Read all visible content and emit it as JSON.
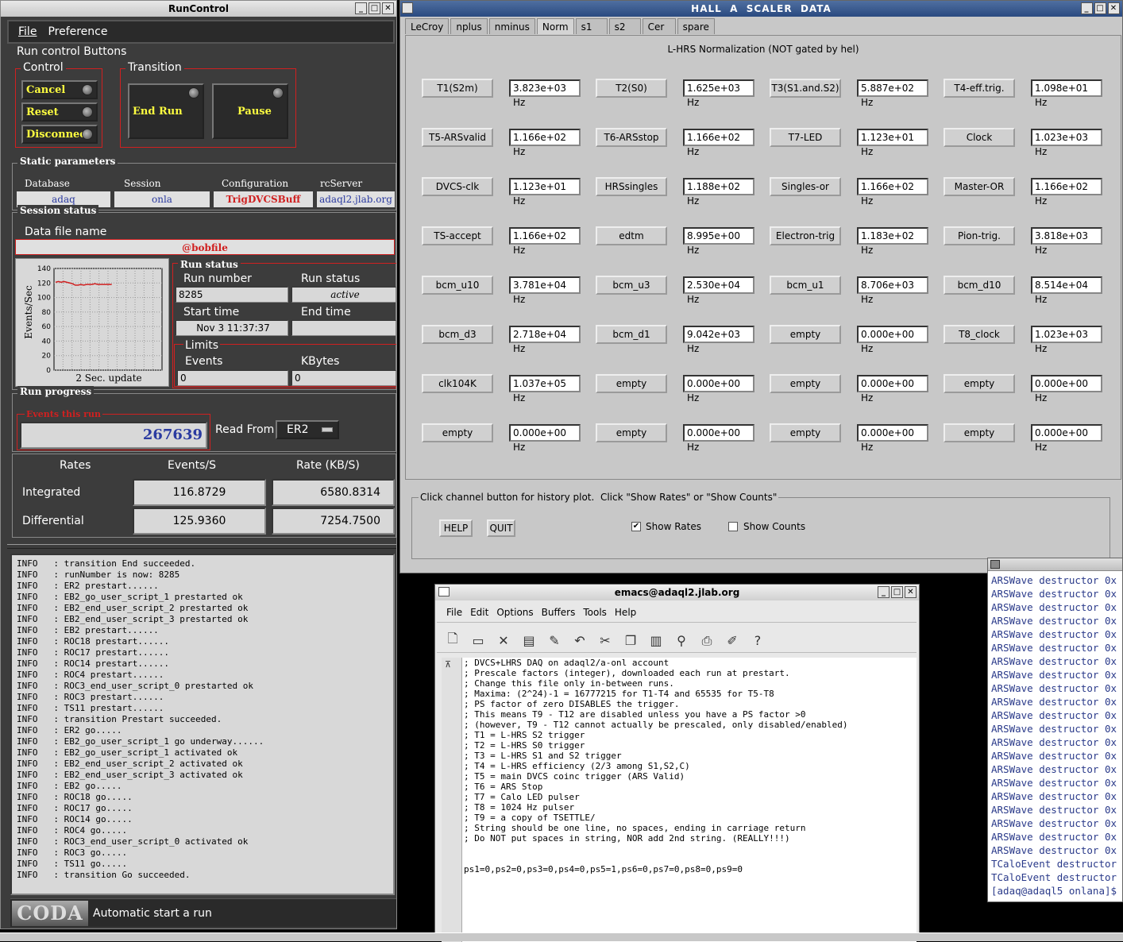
{
  "runcontrol": {
    "title": "RunControl",
    "menu": [
      "File",
      "Preference"
    ],
    "buttons_group": "Run control Buttons",
    "control_label": "Control",
    "transition_label": "Transition",
    "cancel": "Cancel",
    "reset": "Reset",
    "disconnect": "Disconnect",
    "end_run": "End Run",
    "pause": "Pause",
    "static_params": "Static parameters",
    "database_label": "Database",
    "database": "adaq",
    "session_label": "Session",
    "session": "onla",
    "config_label": "Configuration",
    "config": "TrigDVCSBuff",
    "rcserver_label": "rcServer",
    "rcserver": "adaql2.jlab.org",
    "session_status": "Session status",
    "data_file_label": "Data file name",
    "data_file": "@bobfile",
    "plot_ylabel": "Events/Sec",
    "plot_xlabel": "2 Sec. update",
    "run_status_group": "Run status",
    "run_number_label": "Run number",
    "run_number": "8285",
    "run_status_label": "Run status",
    "run_status": "active",
    "start_time_label": "Start time",
    "start_time": "Nov 3 11:37:37",
    "end_time_label": "End time",
    "end_time": "",
    "limits_label": "Limits",
    "events_label": "Events",
    "events_limit": "0",
    "kbytes_label": "KBytes",
    "kbytes_limit": "0",
    "run_progress": "Run progress",
    "events_this_run_label": "Events this run",
    "events_this_run": "267639",
    "read_from_label": "Read From:",
    "read_from": "ER2",
    "rates_header": "Rates",
    "events_s_header": "Events/S",
    "rate_kbs_header": "Rate (KB/S)",
    "integrated_label": "Integrated",
    "integrated_events": "116.8729",
    "integrated_rate": "6580.8314",
    "differential_label": "Differential",
    "differential_events": "125.9360",
    "differential_rate": "7254.7500",
    "coda_logo": "CODA",
    "footer_status": "Automatic start a run",
    "log": [
      "INFO   : transition End succeeded.",
      "INFO   : runNumber is now: 8285",
      "INFO   : ER2 prestart......",
      "INFO   : EB2_go_user_script_1 prestarted ok",
      "INFO   : EB2_end_user_script_2 prestarted ok",
      "INFO   : EB2_end_user_script_3 prestarted ok",
      "INFO   : EB2 prestart......",
      "INFO   : ROC18 prestart......",
      "INFO   : ROC17 prestart......",
      "INFO   : ROC14 prestart......",
      "INFO   : ROC4 prestart......",
      "INFO   : ROC3_end_user_script_0 prestarted ok",
      "INFO   : ROC3 prestart......",
      "INFO   : TS11 prestart......",
      "INFO   : transition Prestart succeeded.",
      "INFO   : ER2 go.....",
      "INFO   : EB2_go_user_script_1 go underway......",
      "INFO   : EB2_go_user_script_1 activated ok",
      "INFO   : EB2_end_user_script_2 activated ok",
      "INFO   : EB2_end_user_script_3 activated ok",
      "INFO   : EB2 go.....",
      "INFO   : ROC18 go.....",
      "INFO   : ROC17 go.....",
      "INFO   : ROC14 go.....",
      "INFO   : ROC4 go.....",
      "INFO   : ROC3_end_user_script_0 activated ok",
      "INFO   : ROC3 go.....",
      "INFO   : TS11 go.....",
      "INFO   : transition Go succeeded."
    ]
  },
  "chart_data": {
    "type": "line",
    "xlabel": "2 Sec. update",
    "ylabel": "Events/Sec",
    "ylim": [
      0,
      140
    ],
    "yticks": [
      0,
      20,
      40,
      60,
      80,
      100,
      120,
      140
    ],
    "grid": true,
    "series": [
      {
        "values": [
          121,
          122,
          121,
          122,
          121,
          120,
          119,
          117,
          117,
          118,
          117,
          118,
          118,
          118,
          119,
          118,
          118,
          118,
          118,
          118,
          118
        ]
      }
    ]
  },
  "scaler": {
    "title": "HALL  A  SCALER  DATA",
    "tabs": [
      "LeCroy",
      "nplus",
      "nminus",
      "Norm",
      "s1",
      "s2",
      "Cer",
      "spare"
    ],
    "active_tab": "Norm",
    "heading": "L-HRS Normalization (NOT gated by hel)",
    "rows": [
      [
        [
          "T1(S2m)",
          "3.823e+03 Hz"
        ],
        [
          "T2(S0)",
          "1.625e+03 Hz"
        ],
        [
          "T3(S1.and.S2)",
          "5.887e+02 Hz"
        ],
        [
          "T4-eff.trig.",
          "1.098e+01 Hz"
        ]
      ],
      [
        [
          "T5-ARSvalid",
          "1.166e+02 Hz"
        ],
        [
          "T6-ARSstop",
          "1.166e+02 Hz"
        ],
        [
          "T7-LED",
          "1.123e+01 Hz"
        ],
        [
          "Clock",
          "1.023e+03 Hz"
        ]
      ],
      [
        [
          "DVCS-clk",
          "1.123e+01 Hz"
        ],
        [
          "HRSsingles",
          "1.188e+02 Hz"
        ],
        [
          "Singles-or",
          "1.166e+02 Hz"
        ],
        [
          "Master-OR",
          "1.166e+02 Hz"
        ]
      ],
      [
        [
          "TS-accept",
          "1.166e+02 Hz"
        ],
        [
          "edtm",
          "8.995e+00 Hz"
        ],
        [
          "Electron-trig",
          "1.183e+02 Hz"
        ],
        [
          "Pion-trig.",
          "3.818e+03 Hz"
        ]
      ],
      [
        [
          "bcm_u10",
          "3.781e+04 Hz"
        ],
        [
          "bcm_u3",
          "2.530e+04 Hz"
        ],
        [
          "bcm_u1",
          "8.706e+03 Hz"
        ],
        [
          "bcm_d10",
          "8.514e+04 Hz"
        ]
      ],
      [
        [
          "bcm_d3",
          "2.718e+04 Hz"
        ],
        [
          "bcm_d1",
          "9.042e+03 Hz"
        ],
        [
          "empty",
          "0.000e+00 Hz"
        ],
        [
          "T8_clock",
          "1.023e+03 Hz"
        ]
      ],
      [
        [
          "clk104K",
          "1.037e+05 Hz"
        ],
        [
          "empty",
          "0.000e+00 Hz"
        ],
        [
          "empty",
          "0.000e+00 Hz"
        ],
        [
          "empty",
          "0.000e+00 Hz"
        ]
      ],
      [
        [
          "empty",
          "0.000e+00 Hz"
        ],
        [
          "empty",
          "0.000e+00 Hz"
        ],
        [
          "empty",
          "0.000e+00 Hz"
        ],
        [
          "empty",
          "0.000e+00 Hz"
        ]
      ]
    ],
    "instructions": "Click channel button for history plot.  Click \"Show Rates\" or \"Show Counts\"",
    "help": "HELP",
    "quit": "QUIT",
    "show_rates": "Show Rates",
    "show_counts": "Show Counts"
  },
  "emacs": {
    "title": "emacs@adaql2.jlab.org",
    "menu": [
      "File",
      "Edit",
      "Options",
      "Buffers",
      "Tools",
      "Help"
    ],
    "text": [
      "; DVCS+LHRS DAQ on adaql2/a-onl account",
      "; Prescale factors (integer), downloaded each run at prestart.",
      "; Change this file only in-between runs.",
      "; Maxima: (2^24)-1 = 16777215 for T1-T4 and 65535 for T5-T8",
      "; PS factor of zero DISABLES the trigger.",
      "; This means T9 - T12 are disabled unless you have a PS factor >0",
      "; (however, T9 - T12 cannot actually be prescaled, only disabled/enabled)",
      "; T1 = L-HRS S2 trigger",
      "; T2 = L-HRS S0 trigger",
      "; T3 = L-HRS S1 and S2 trigger",
      "; T4 = L-HRS efficiency (2/3 among S1,S2,C)",
      "; T5 = main DVCS coinc trigger (ARS Valid)",
      "; T6 = ARS Stop",
      "; T7 = Calo LED pulser",
      "; T8 = 1024 Hz pulser",
      "; T9 = a copy of TSETTLE/",
      "; String should be one line, no spaces, ending in carriage return",
      "; Do NOT put spaces in string, NOR add 2nd string. (REALLY!!!)",
      "",
      "",
      "ps1=0,ps2=0,ps3=0,ps4=0,ps5=1,ps6=0,ps7=0,ps8=0,ps9=0"
    ]
  },
  "xterm": {
    "lines": [
      "ARSWave destructor 0x",
      "ARSWave destructor 0x",
      "ARSWave destructor 0x",
      "ARSWave destructor 0x",
      "ARSWave destructor 0x",
      "ARSWave destructor 0x",
      "ARSWave destructor 0x",
      "ARSWave destructor 0x",
      "ARSWave destructor 0x",
      "ARSWave destructor 0x",
      "ARSWave destructor 0x",
      "ARSWave destructor 0x",
      "ARSWave destructor 0x",
      "ARSWave destructor 0x",
      "ARSWave destructor 0x",
      "ARSWave destructor 0x",
      "ARSWave destructor 0x",
      "ARSWave destructor 0x",
      "ARSWave destructor 0x",
      "ARSWave destructor 0x",
      "ARSWave destructor 0x",
      "TCaloEvent destructor",
      "TCaloEvent destructor",
      "[adaq@adaql5 onlana]$"
    ]
  }
}
